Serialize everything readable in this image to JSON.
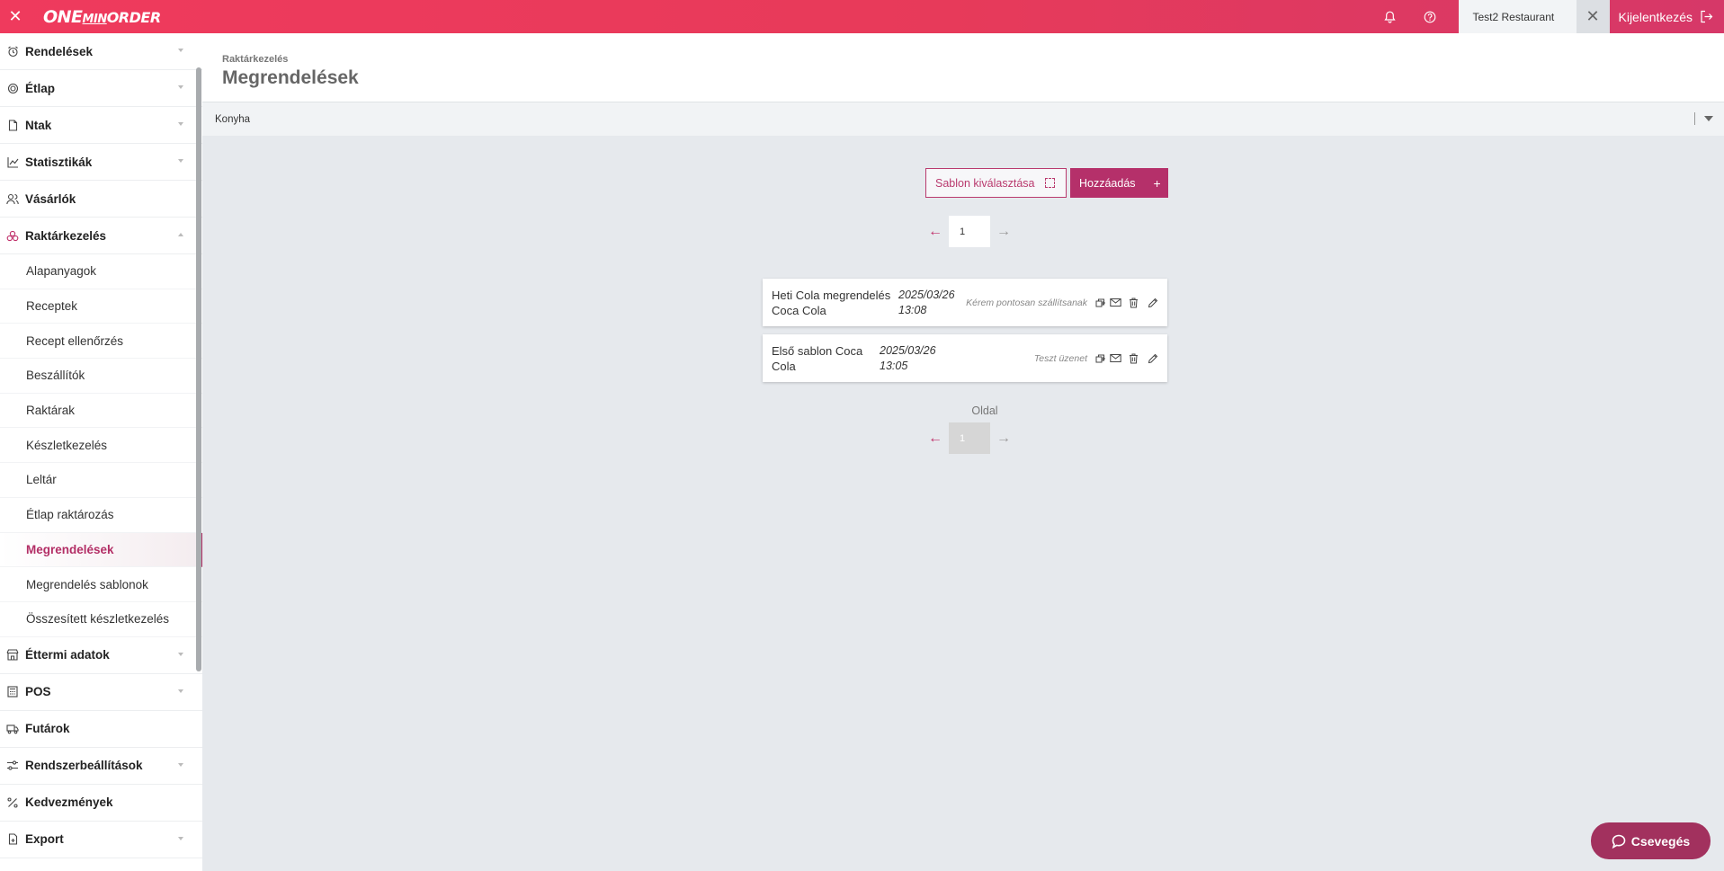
{
  "topbar": {
    "close_glyph": "✕",
    "logo_one": "ONE",
    "logo_min": "MIN",
    "logo_order": "ORDER",
    "restaurant": "Test2 Restaurant",
    "restaurant_close_glyph": "✕",
    "logout_label": "Kijelentkezés",
    "icons": [
      "bell-icon",
      "help-icon",
      "logout-icon"
    ]
  },
  "sidebar": {
    "items_top": [
      {
        "label": "Rendelések",
        "icon": "alarm-icon"
      },
      {
        "label": "Étlap",
        "icon": "plate-icon"
      },
      {
        "label": "Ntak",
        "icon": "document-icon"
      },
      {
        "label": "Statisztikák",
        "icon": "chart-icon"
      },
      {
        "label": "Vásárlók",
        "icon": "users-icon"
      },
      {
        "label": "Raktárkezelés",
        "icon": "boxes-icon"
      }
    ],
    "sub_items": [
      "Alapanyagok",
      "Receptek",
      "Recept ellenőrzés",
      "Beszállítók",
      "Raktárak",
      "Készletkezelés",
      "Leltár",
      "Étlap raktározás",
      "Megrendelések",
      "Megrendelés sablonok",
      "Összesített készletkezelés"
    ],
    "items_bottom": [
      {
        "label": "Éttermi adatok",
        "icon": "store-icon"
      },
      {
        "label": "POS",
        "icon": "pos-icon"
      },
      {
        "label": "Futárok",
        "icon": "courier-icon"
      },
      {
        "label": "Rendszerbeállítások",
        "icon": "sliders-icon"
      },
      {
        "label": "Kedvezmények",
        "icon": "percent-icon"
      },
      {
        "label": "Export",
        "icon": "export-icon"
      }
    ]
  },
  "header": {
    "breadcrumb": "Raktárkezelés",
    "title": "Megrendelések"
  },
  "filter": {
    "value": "Konyha"
  },
  "actions": {
    "template_label": "Sablon kiválasztása",
    "add_label": "Hozzáadás",
    "add_plus": "+"
  },
  "pagination": {
    "top_page": "1",
    "page_label": "Oldal",
    "bottom_page": "1",
    "prev_glyph": "←",
    "next_glyph": "→"
  },
  "orders": [
    {
      "name_line1": "Heti Cola megrendelés",
      "name_line2": "Coca Cola",
      "date": "2025/03/26",
      "time": "13:08",
      "message": "Kérem pontosan szállítsanak"
    },
    {
      "name_line1": "Első sablon Coca",
      "name_line2": "Cola",
      "date": "2025/03/26",
      "time": "13:05",
      "message": "Teszt üzenet"
    }
  ],
  "chat": {
    "label": "Csevegés"
  }
}
